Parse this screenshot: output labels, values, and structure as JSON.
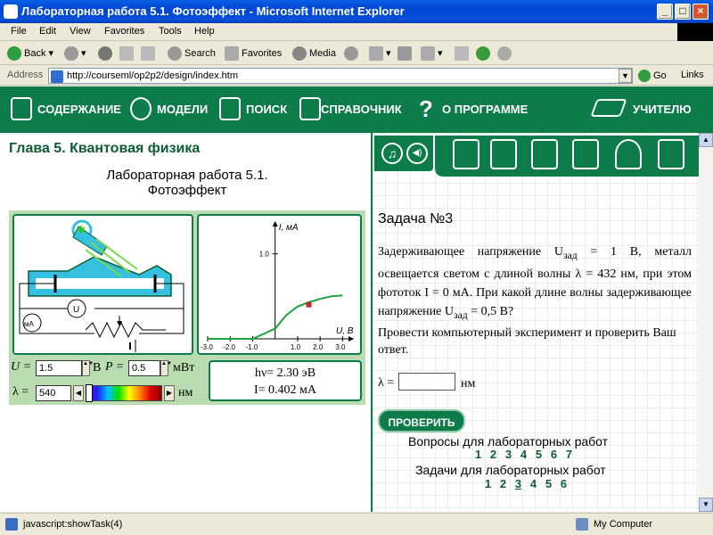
{
  "window": {
    "title": "Лабораторная работа 5.1. Фотоэффект - Microsoft Internet Explorer",
    "min": "_",
    "max": "□",
    "close": "×"
  },
  "menu": [
    "File",
    "Edit",
    "View",
    "Favorites",
    "Tools",
    "Help"
  ],
  "toolbar": {
    "back": "Back",
    "search": "Search",
    "favorites": "Favorites",
    "media": "Media"
  },
  "address": {
    "label": "Address",
    "url": "http://courseml/op2p2/design/index.htm",
    "go": "Go",
    "links": "Links"
  },
  "nav": {
    "items": [
      "СОДЕРЖАНИЕ",
      "МОДЕЛИ",
      "ПОИСК",
      "СПРАВОЧНИК",
      "О ПРОГРАММЕ",
      "УЧИТЕЛЮ"
    ],
    "qmark": "?"
  },
  "left": {
    "chapter": "Глава 5. Квантовая физика",
    "lab_title_1": "Лабораторная работа 5.1.",
    "lab_title_2": "Фотоэффект",
    "circuit": {
      "u": "U",
      "ma": "мА"
    },
    "controls": {
      "u_label": "U =",
      "u_value": "1.5",
      "u_unit": "В",
      "p_label": "P =",
      "p_value": "0.5",
      "p_unit": "мВт",
      "lambda_label": "λ =",
      "lambda_value": "540",
      "lambda_unit": "нм"
    },
    "readout": {
      "hv": "hν= 2.30 эВ",
      "i": "I= 0.402 мА"
    }
  },
  "chart_data": {
    "type": "line",
    "ylabel": "I, мА",
    "xlabel": "U, В",
    "xlim": [
      -3.0,
      3.5
    ],
    "ylim": [
      0,
      1.3
    ],
    "xticks": [
      "-3.0",
      "-2.0",
      "-1.0",
      "1.0",
      "2.0",
      "3.0"
    ],
    "yticks": [
      "1.0"
    ],
    "series": [
      {
        "x": [
          -3.0,
          -1.0,
          0.0,
          0.5,
          1.0,
          1.5,
          2.0,
          2.5,
          3.0
        ],
        "y": [
          0,
          0,
          0.12,
          0.28,
          0.38,
          0.43,
          0.47,
          0.5,
          0.51
        ]
      }
    ],
    "marker": {
      "x": 1.5,
      "y": 0.402
    }
  },
  "right": {
    "task_title": "Задача №3",
    "p1": "Задерживающее напряжение U",
    "p1_sub": "зад",
    "p1_rest": " = 1 В, металл освещается светом с длиной волны λ = 432 нм, при этом фототок I = 0 мА. При какой длине волны задерживающее напряжение U",
    "p1_rest2": " = 0,5 В?",
    "p2": "Провести компьютерный эксперимент и проверить Ваш ответ.",
    "answer_label": "λ =",
    "answer_value": "",
    "answer_unit": "нм",
    "check": "ПРОВЕРИТЬ",
    "questions_title": "Вопросы для лабораторных работ",
    "questions": [
      "1",
      "2",
      "3",
      "4",
      "5",
      "6",
      "7"
    ],
    "tasks_title": "Задачи для лабораторных работ",
    "tasks": [
      "1",
      "2",
      "3",
      "4",
      "5",
      "6"
    ]
  },
  "status": {
    "text": "javascript:showTask(4)",
    "zone": "My Computer"
  }
}
